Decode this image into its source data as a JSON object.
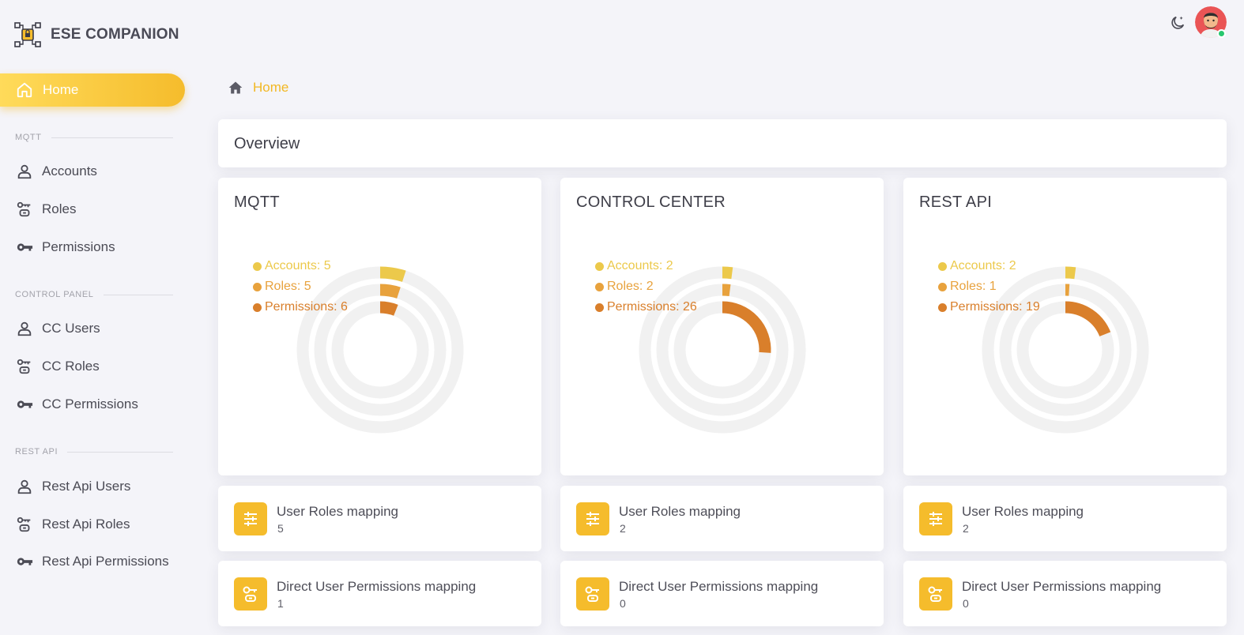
{
  "app": {
    "title": "ESE COMPANION"
  },
  "sidebar": {
    "home_label": "Home",
    "sections": [
      {
        "label": "MQTT",
        "items": [
          {
            "label": "Accounts",
            "icon": "user-icon"
          },
          {
            "label": "Roles",
            "icon": "roles-icon"
          },
          {
            "label": "Permissions",
            "icon": "key-icon"
          }
        ]
      },
      {
        "label": "CONTROL PANEL",
        "items": [
          {
            "label": "CC Users",
            "icon": "user-icon"
          },
          {
            "label": "CC Roles",
            "icon": "roles-icon"
          },
          {
            "label": "CC Permissions",
            "icon": "key-icon"
          }
        ]
      },
      {
        "label": "REST API",
        "items": [
          {
            "label": "Rest Api Users",
            "icon": "user-icon"
          },
          {
            "label": "Rest Api Roles",
            "icon": "roles-icon"
          },
          {
            "label": "Rest Api Permissions",
            "icon": "key-icon"
          }
        ]
      }
    ]
  },
  "breadcrumb": {
    "current": "Home"
  },
  "overview": {
    "title": "Overview"
  },
  "colors": {
    "accent": "#f5bc2c",
    "accounts": "#ecc94b",
    "roles": "#e8a23d",
    "permissions": "#d97f2b",
    "track": "#f1f1f1"
  },
  "panels": [
    {
      "title": "MQTT",
      "legend": [
        "Accounts: 5",
        "Roles: 5",
        "Permissions: 6"
      ],
      "stats": [
        {
          "title": "User Roles mapping",
          "value": "5"
        },
        {
          "title": "Direct User Permissions mapping",
          "value": "1"
        }
      ]
    },
    {
      "title": "CONTROL CENTER",
      "legend": [
        "Accounts: 2",
        "Roles: 2",
        "Permissions: 26"
      ],
      "stats": [
        {
          "title": "User Roles mapping",
          "value": "2"
        },
        {
          "title": "Direct User Permissions mapping",
          "value": "0"
        }
      ]
    },
    {
      "title": "REST API",
      "legend": [
        "Accounts: 2",
        "Roles: 1",
        "Permissions: 19"
      ],
      "stats": [
        {
          "title": "User Roles mapping",
          "value": "2"
        },
        {
          "title": "Direct User Permissions mapping",
          "value": "0"
        }
      ]
    }
  ],
  "chart_data": [
    {
      "type": "radialBar",
      "title": "MQTT",
      "categories": [
        "Accounts",
        "Roles",
        "Permissions"
      ],
      "values": [
        5,
        5,
        6
      ],
      "max": 100
    },
    {
      "type": "radialBar",
      "title": "CONTROL CENTER",
      "categories": [
        "Accounts",
        "Roles",
        "Permissions"
      ],
      "values": [
        2,
        2,
        26
      ],
      "max": 100
    },
    {
      "type": "radialBar",
      "title": "REST API",
      "categories": [
        "Accounts",
        "Roles",
        "Permissions"
      ],
      "values": [
        2,
        1,
        19
      ],
      "max": 100
    }
  ]
}
